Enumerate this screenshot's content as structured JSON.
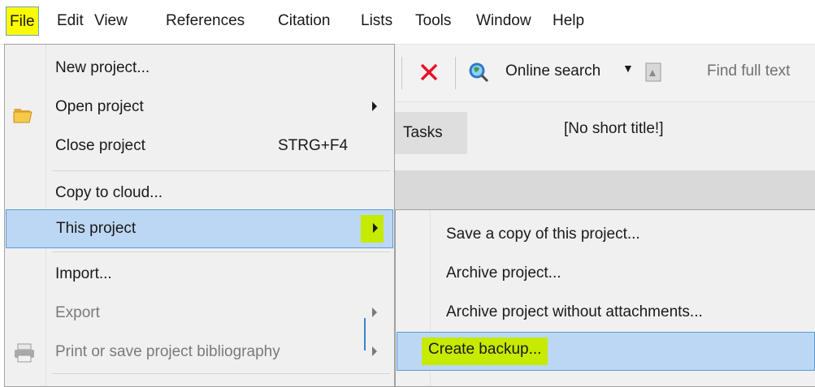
{
  "menubar": {
    "items": [
      "File",
      "Edit",
      "View",
      "References",
      "Citation",
      "Lists",
      "Tools",
      "Window",
      "Help"
    ]
  },
  "toolbar": {
    "online_search": "Online search",
    "find_full_text": "Find full text"
  },
  "workspace": {
    "tasks_tab": "Tasks",
    "short_title": "[No short title!]"
  },
  "file_menu": {
    "new_project": "New project...",
    "open_project": "Open project",
    "close_project": "Close project",
    "close_shortcut": "STRG+F4",
    "copy_to_cloud": "Copy to cloud...",
    "this_project": "This project",
    "import": "Import...",
    "export": "Export",
    "print_bibliography": "Print or save project bibliography"
  },
  "submenu": {
    "save_copy": "Save a copy of this project...",
    "archive_project": "Archive project...",
    "archive_without_attachments": "Archive project without attachments...",
    "create_backup": "Create backup..."
  },
  "colors": {
    "highlight_yellow": "#fbfb00",
    "annotation_green": "#c6ea00",
    "menu_selection": "#bcd7f3",
    "delete_red": "#e81123"
  }
}
